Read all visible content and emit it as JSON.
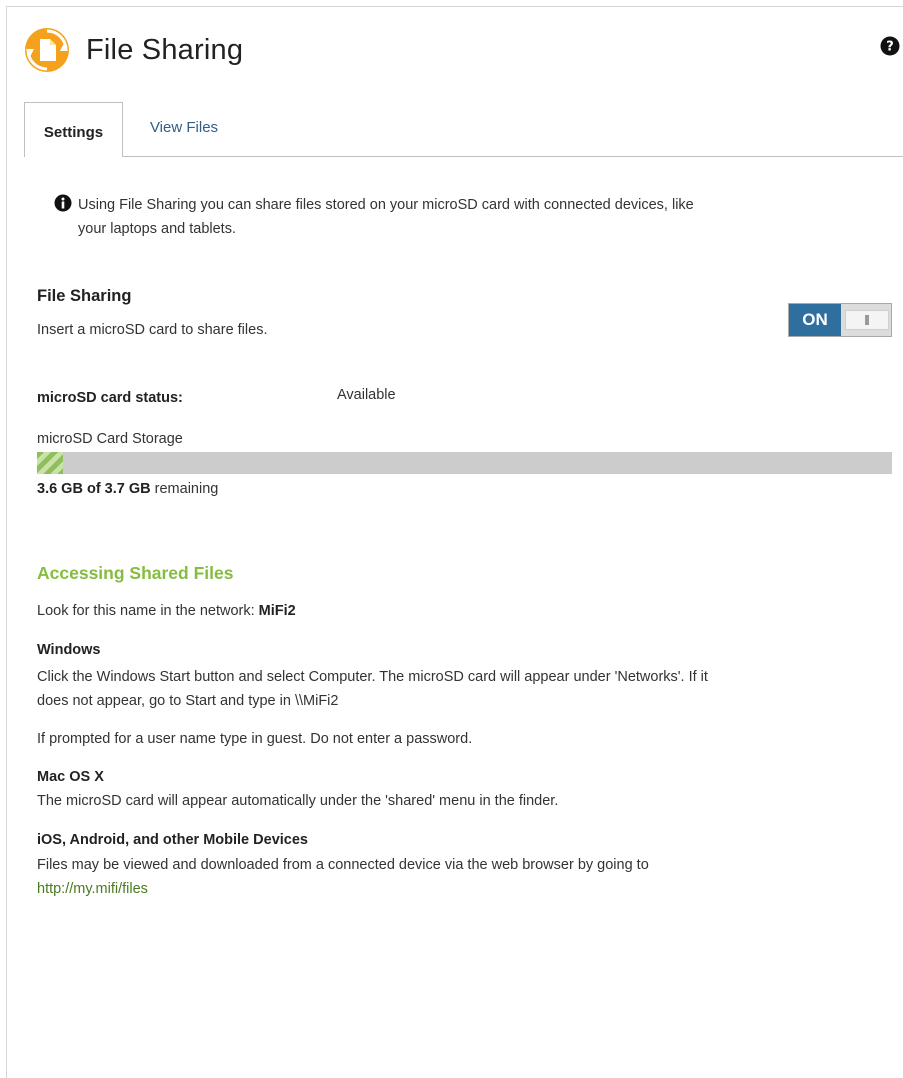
{
  "page": {
    "title": "File Sharing",
    "tabs": [
      {
        "label": "Settings",
        "active": true
      },
      {
        "label": "View Files",
        "active": false
      }
    ],
    "info": {
      "line1": "Using File Sharing you can share files stored on your microSD card with connected devices, like",
      "line2": "your laptops and tablets."
    }
  },
  "file_sharing": {
    "heading": "File Sharing",
    "description": "Insert a microSD card to share files.",
    "toggle_label": "ON",
    "toggle_state": "on"
  },
  "card": {
    "status_label": "microSD card status:",
    "status_value": "Available",
    "storage_label": "microSD Card Storage",
    "used_fraction": 0.03,
    "remaining_bold": "3.6 GB of 3.7 GB",
    "remaining_suffix": " remaining"
  },
  "access": {
    "heading": "Accessing Shared Files",
    "network_prefix": "Look for this name in the network: ",
    "network_name": "MiFi2",
    "windows_heading": "Windows",
    "windows_line1": "Click the Windows Start button and select Computer. The microSD card will appear under 'Networks'. If it",
    "windows_line2": "does not appear, go to Start and type in \\\\MiFi2",
    "guest_note": "If prompted for a user name type in guest. Do not enter a password.",
    "mac_heading": "Mac OS X",
    "mac_text": "The microSD card will appear automatically under the 'shared' menu in the finder.",
    "mobile_heading": "iOS, Android, and other Mobile Devices",
    "mobile_text": "Files may be viewed and downloaded from a connected device via the web browser by going to",
    "mobile_link": "http://my.mifi/files"
  },
  "colors": {
    "accent_green": "#86bc3f",
    "toggle_blue": "#2e6f9f",
    "icon_orange": "#f4a21d"
  },
  "icons": {
    "app": "file-sharing-icon",
    "help": "help-icon",
    "info": "info-icon"
  }
}
